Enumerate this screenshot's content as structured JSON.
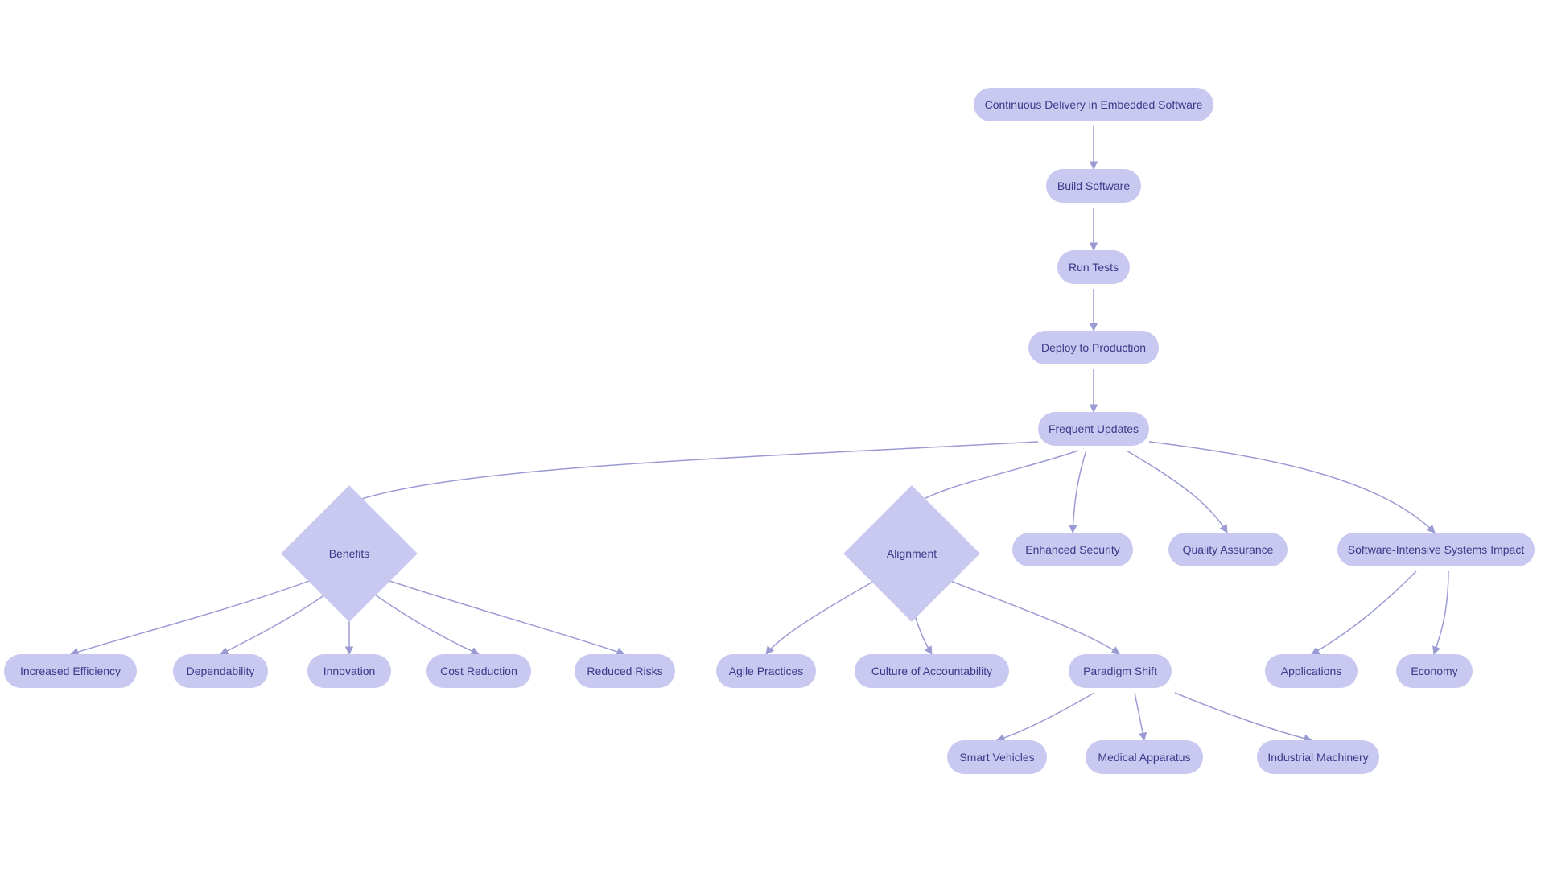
{
  "colors": {
    "node_fill": "#c8c8f0",
    "node_text": "#3a3a8a",
    "edge": "#9b9bd4"
  },
  "nodes": {
    "root": "Continuous Delivery in Embedded Software",
    "build": "Build Software",
    "tests": "Run Tests",
    "deploy": "Deploy to Production",
    "updates": "Frequent Updates",
    "benefits": "Benefits",
    "alignment": "Alignment",
    "security": "Enhanced Security",
    "qa": "Quality Assurance",
    "impact": "Software-Intensive Systems Impact",
    "efficiency": "Increased Efficiency",
    "dependability": "Dependability",
    "innovation": "Innovation",
    "cost": "Cost Reduction",
    "risks": "Reduced Risks",
    "agile": "Agile Practices",
    "culture": "Culture of Accountability",
    "paradigm": "Paradigm Shift",
    "applications": "Applications",
    "economy": "Economy",
    "smart": "Smart Vehicles",
    "medical": "Medical Apparatus",
    "industrial": "Industrial Machinery"
  }
}
